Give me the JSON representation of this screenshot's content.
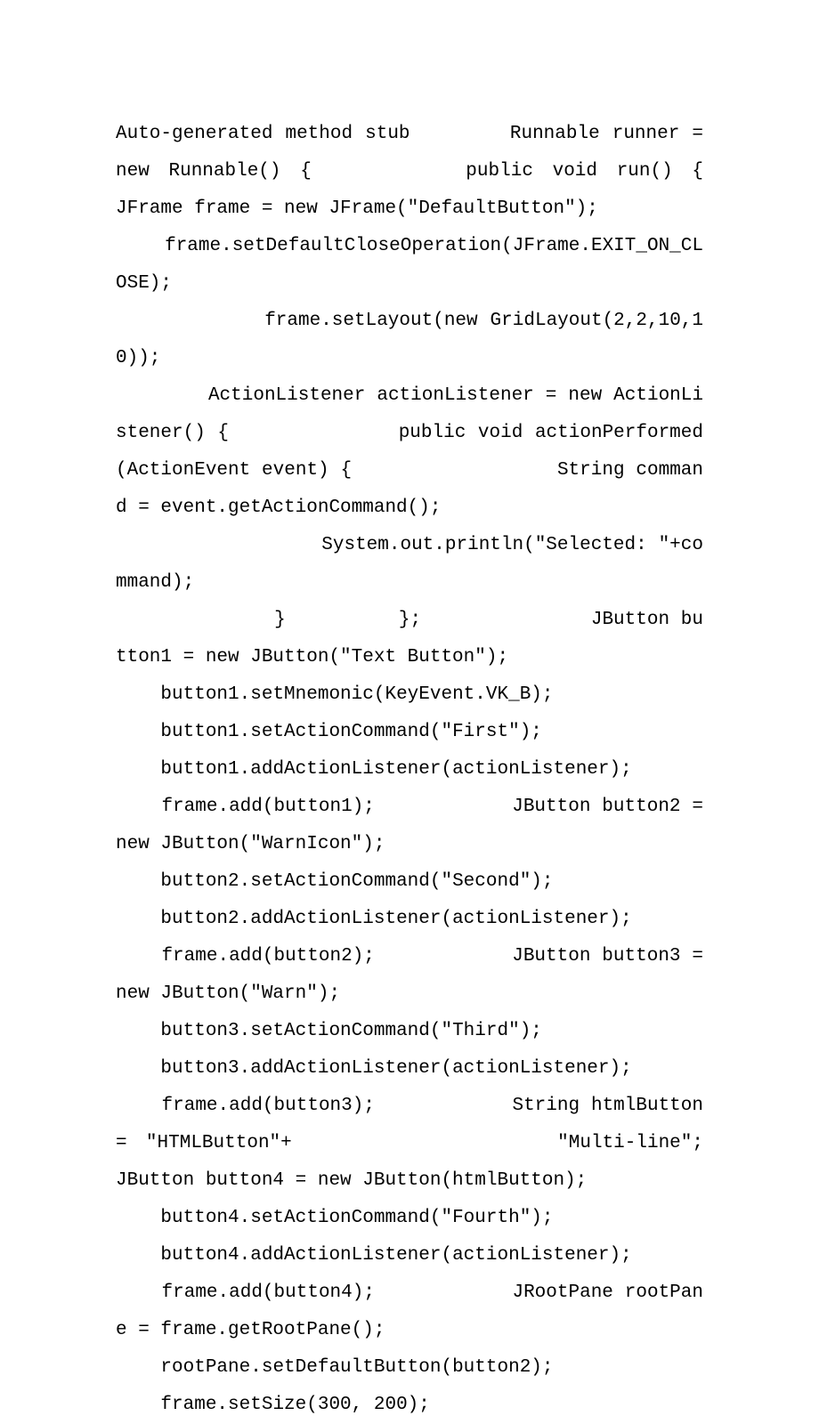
{
  "code": {
    "lines": [
      "Auto-generated method stub        Runnable runner = new Runnable() {        public void run() {            JFrame frame = new JFrame(\"DefaultButton\");",
      "    frame.setDefaultCloseOperation(JFrame.EXIT_ON_CLOSE);",
      "            frame.setLayout(new GridLayout(2,2,10,10));",
      "        ActionListener actionListener = new ActionListener() {              public void actionPerformed(ActionEvent event) {                  String command = event.getActionCommand();",
      "                  System.out.println(\"Selected: \"+command);",
      "              }          };               JButton button1 = new JButton(\"Text Button\");",
      "    button1.setMnemonic(KeyEvent.VK_B);",
      "    button1.setActionCommand(\"First\");",
      "    button1.addActionListener(actionListener);",
      "    frame.add(button1);            JButton button2 = new JButton(\"WarnIcon\");",
      "    button2.setActionCommand(\"Second\");",
      "    button2.addActionListener(actionListener);",
      "    frame.add(button2);            JButton button3 = new JButton(\"Warn\");",
      "    button3.setActionCommand(\"Third\");",
      "    button3.addActionListener(actionListener);",
      "    frame.add(button3);            String htmlButton = \"HTMLButton\"+              \"Multi-line\";           JButton button4 = new JButton(htmlButton);",
      "    button4.setActionCommand(\"Fourth\");",
      "    button4.addActionListener(actionListener);",
      "    frame.add(button4);            JRootPane rootPane = frame.getRootPane();",
      "    rootPane.setDefaultButton(button2);",
      "    frame.setSize(300, 200);"
    ]
  }
}
